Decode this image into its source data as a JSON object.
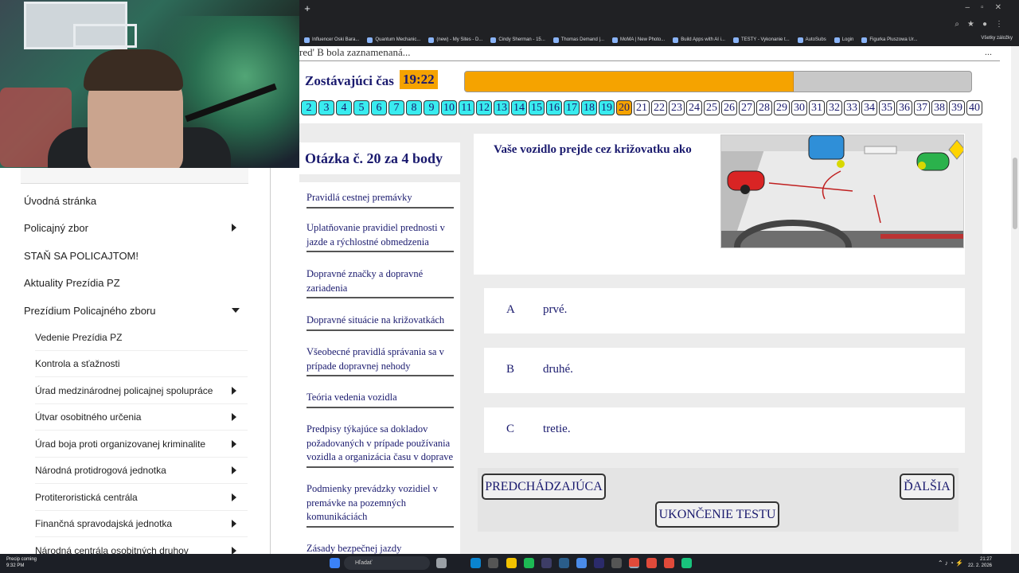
{
  "bookmarks": [
    "Influencer Oski Bara...",
    "Quantum Mechanic...",
    "(new) - My Sites - D...",
    "Cindy Sherman - 15...",
    "Thomas Demand |...",
    "MoMA | New Photo...",
    "Build Apps with AI i...",
    "TESTY - Vykonanie t...",
    "AutoSubs",
    "Login",
    "Figurka Pluszowa Ur..."
  ],
  "bookmarks_all": "Všetky záložky",
  "top_note": "red' B bola zaznamenaná...",
  "timer": {
    "label": "Zostávajúci čas",
    "value": "19:22",
    "progress_fraction": 0.65
  },
  "question_numbers": [
    "2",
    "3",
    "4",
    "5",
    "6",
    "7",
    "8",
    "9",
    "10",
    "11",
    "12",
    "13",
    "14",
    "15",
    "16",
    "17",
    "18",
    "19",
    "20",
    "21",
    "22",
    "23",
    "24",
    "25",
    "26",
    "27",
    "28",
    "29",
    "30",
    "31",
    "32",
    "33",
    "34",
    "35",
    "36",
    "37",
    "38",
    "39",
    "40"
  ],
  "current_question": "20",
  "question_heading": "Otázka č. 20 za 4 body",
  "categories": [
    "Pravidlá cestnej premávky",
    "Uplatňovanie pravidiel prednosti v jazde a rýchlostné obmedzenia",
    "Dopravné značky a dopravné zariadenia",
    "Dopravné situácie na križovatkách",
    "Všeobecné pravidlá správania sa v prípade dopravnej nehody",
    "Teória vedenia vozidla",
    "Predpisy týkajúce sa dokladov požadovaných v prípade používania vozidla a organizácia času v doprave",
    "Podmienky prevádzky vozidiel v premávke na pozemných komunikáciách",
    "Zásady bezpečnej jazdy"
  ],
  "question_text": "Vaše vozidlo prejde cez križovatku ako",
  "answers": [
    {
      "letter": "A",
      "text": "prvé."
    },
    {
      "letter": "B",
      "text": "druhé."
    },
    {
      "letter": "C",
      "text": "tretie."
    }
  ],
  "buttons": {
    "prev": "PREDCHÁDZAJÚCA",
    "next": "ĎALŠIA",
    "finish": "UKONČENIE TESTU"
  },
  "sidebar": [
    {
      "label": "Úvodná stránka",
      "arrow": ""
    },
    {
      "label": "Policajný zbor",
      "arrow": "right"
    },
    {
      "label": "STAŇ SA POLICAJTOM!",
      "arrow": ""
    },
    {
      "label": "Aktuality Prezídia PZ",
      "arrow": ""
    },
    {
      "label": "Prezídium Policajného zboru",
      "arrow": "down"
    }
  ],
  "sidebar_sub": [
    {
      "label": "Vedenie Prezídia PZ",
      "arrow": ""
    },
    {
      "label": "Kontrola a sťažnosti",
      "arrow": ""
    },
    {
      "label": "Úrad medzinárodnej policajnej spolupráce",
      "arrow": "right"
    },
    {
      "label": "Útvar osobitného určenia",
      "arrow": "right"
    },
    {
      "label": "Úrad boja proti organizovanej kriminalite",
      "arrow": "right"
    },
    {
      "label": "Národná protidrogová jednotka",
      "arrow": "right"
    },
    {
      "label": "Protiteroristická centrála",
      "arrow": "right"
    },
    {
      "label": "Finančná spravodajská jednotka",
      "arrow": "right"
    },
    {
      "label": "Národná centrála osobitných druhov",
      "arrow": "right"
    }
  ],
  "taskbar": {
    "weather_title": "Precip coming",
    "weather_time": "9:32 PM",
    "search": "Hľadať",
    "time": "21:27",
    "date": "22. 2. 2026"
  },
  "colors": {
    "accent_orange": "#f5a300",
    "done_cyan": "#39ecef",
    "navy_text": "#1a1a6e"
  }
}
